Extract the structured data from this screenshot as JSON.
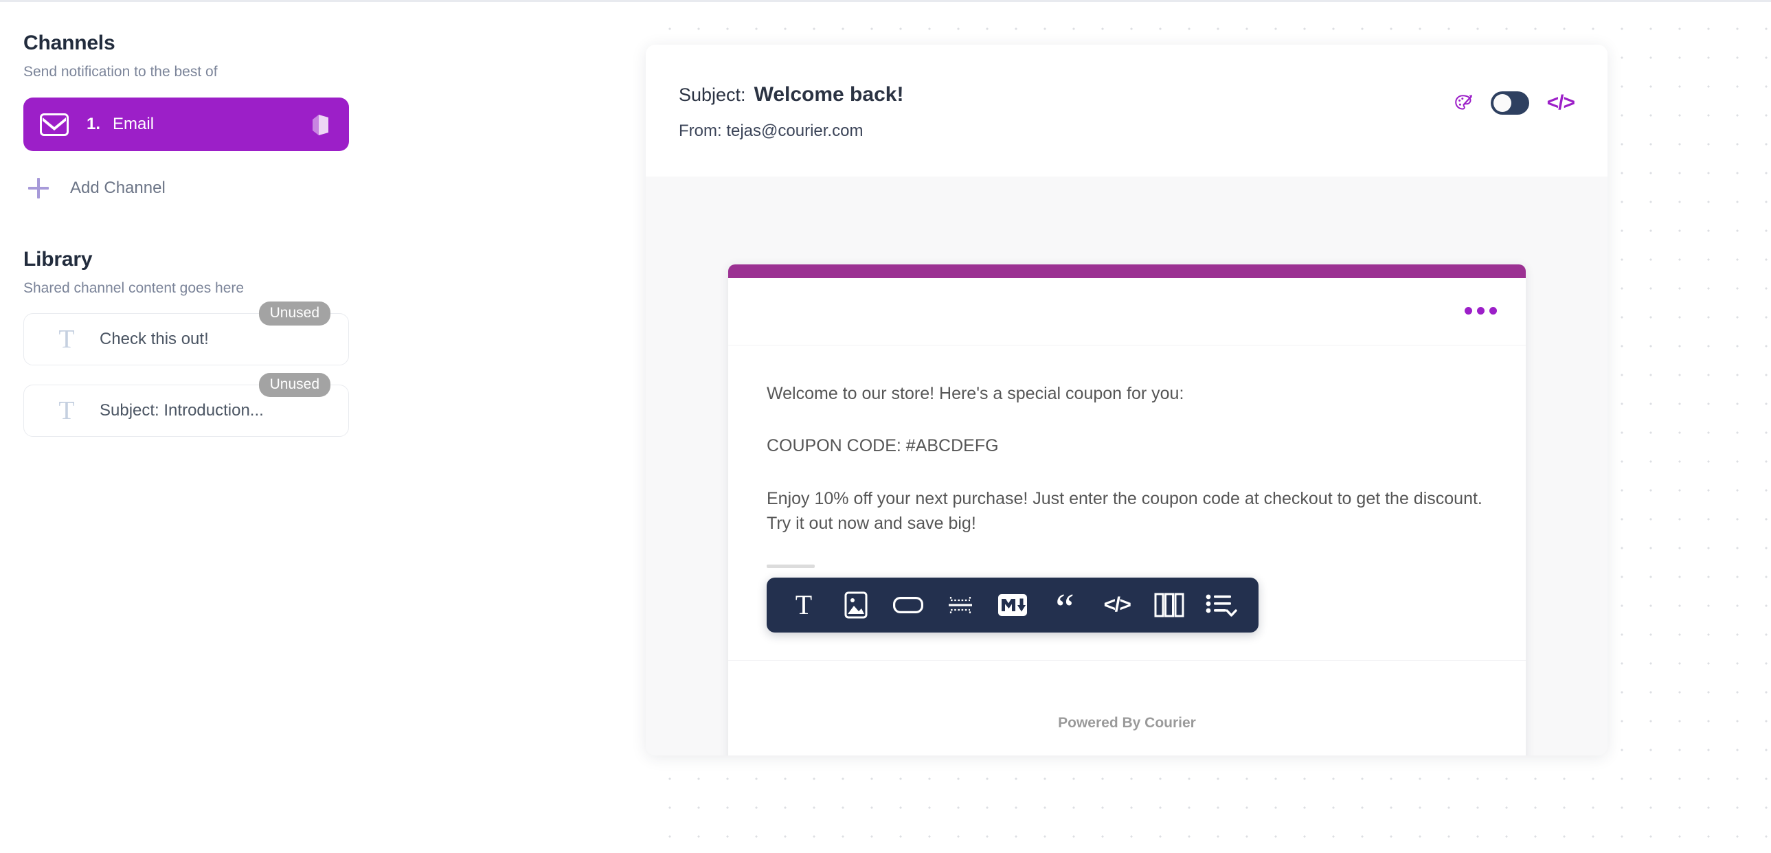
{
  "sidebar": {
    "channels": {
      "title": "Channels",
      "subtitle": "Send notification to the best of",
      "items": [
        {
          "index": "1.",
          "name": "Email",
          "icon": "envelope-icon",
          "badge_icon": "book-icon",
          "active": true
        }
      ],
      "add_channel_label": "Add Channel",
      "add_channel_icon": "plus-icon"
    },
    "library": {
      "title": "Library",
      "subtitle": "Shared channel content goes here",
      "items": [
        {
          "icon": "text-block-icon",
          "label": "Check this out!",
          "badge": "Unused"
        },
        {
          "icon": "text-block-icon",
          "label": "Subject: Introduction...",
          "badge": "Unused"
        }
      ]
    }
  },
  "preview": {
    "header": {
      "subject_label": "Subject:",
      "subject_value": "Welcome back!",
      "from_text": "From: tejas@courier.com",
      "controls": [
        {
          "name": "brand-palette-icon",
          "type": "icon"
        },
        {
          "name": "preview-mode-toggle",
          "type": "toggle",
          "state": "off"
        },
        {
          "name": "view-code-icon",
          "type": "icon",
          "glyph": "</>"
        }
      ]
    },
    "card": {
      "menu_icon": "overflow-dots-icon",
      "paragraphs": [
        "Welcome to our store! Here's a special coupon for you:",
        "COUPON CODE: #ABCDEFG",
        "Enjoy 10% off your next purchase! Just enter the coupon code at checkout to get the discount. Try it out now and save big!"
      ],
      "footer_text": "Powered By Courier"
    },
    "toolbar": {
      "items": [
        {
          "name": "text-block-tool",
          "label": "Text"
        },
        {
          "name": "image-block-tool",
          "label": "Image"
        },
        {
          "name": "action-button-tool",
          "label": "Button"
        },
        {
          "name": "divider-block-tool",
          "label": "Divider"
        },
        {
          "name": "markdown-block-tool",
          "label": "Markdown"
        },
        {
          "name": "quote-block-tool",
          "label": "Quote"
        },
        {
          "name": "html-block-tool",
          "label": "HTML"
        },
        {
          "name": "columns-block-tool",
          "label": "Columns"
        },
        {
          "name": "list-block-tool",
          "label": "List"
        }
      ]
    }
  },
  "colors": {
    "brand_purple": "#9C1FC8",
    "card_strip": "#9B3192",
    "toolbar_bg": "#23304e",
    "toggle_track": "#2e4060",
    "badge_gray": "#a3a3a3",
    "heading": "#222c3d",
    "muted_text": "#7b8499"
  }
}
